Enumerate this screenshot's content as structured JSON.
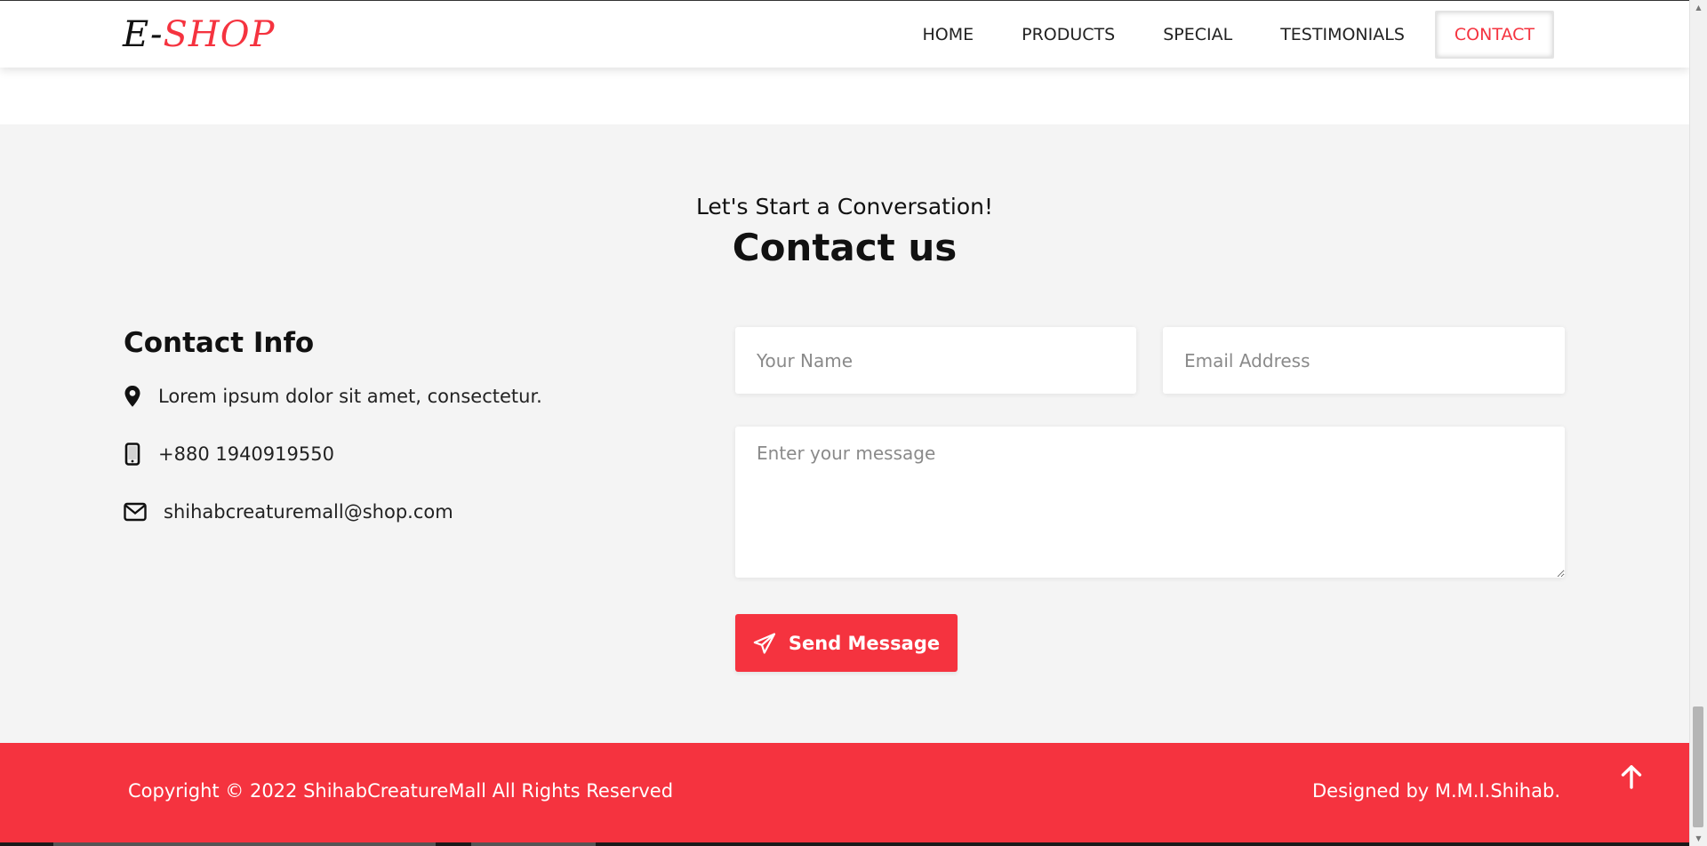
{
  "header": {
    "logo": {
      "part1": "E",
      "dash": "-",
      "part2": "SHOP"
    },
    "nav": [
      {
        "label": "HOME",
        "active": false
      },
      {
        "label": "PRODUCTS",
        "active": false
      },
      {
        "label": "SPECIAL",
        "active": false
      },
      {
        "label": "TESTIMONIALS",
        "active": false
      },
      {
        "label": "CONTACT",
        "active": true
      }
    ]
  },
  "contact": {
    "subtitle": "Let's Start a Conversation!",
    "title": "Contact us",
    "info_title": "Contact Info",
    "info": [
      {
        "icon": "location-pin-icon",
        "text": "Lorem ipsum dolor sit amet, consectetur."
      },
      {
        "icon": "mobile-phone-icon",
        "text": "+880 1940919550"
      },
      {
        "icon": "envelope-icon",
        "text": "shihabcreaturemall@shop.com"
      }
    ],
    "form": {
      "name_placeholder": "Your Name",
      "email_placeholder": "Email Address",
      "message_placeholder": "Enter your message",
      "send_label": "Send Message",
      "send_icon": "paper-plane-icon"
    }
  },
  "footer": {
    "copyright": "Copyright © 2022 ShihabCreatureMall All Rights Reserved",
    "designed_by": "Designed by M.M.I.Shihab.",
    "to_top_icon": "arrow-up-icon"
  },
  "colors": {
    "accent": "#f5333f",
    "section_bg": "#f4f4f4",
    "text": "#111111"
  }
}
